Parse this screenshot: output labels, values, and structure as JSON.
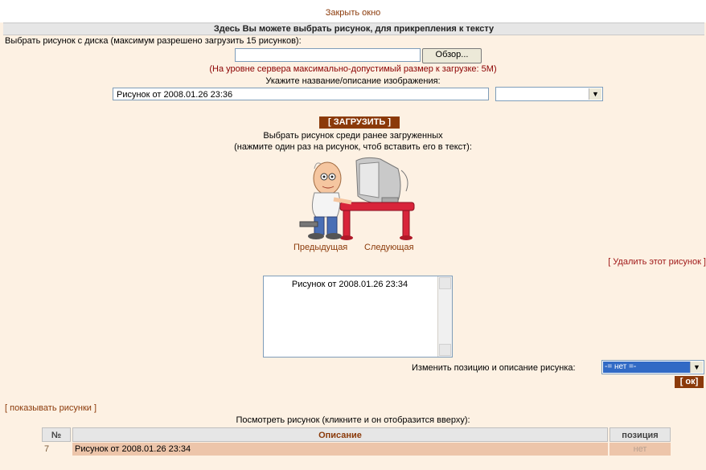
{
  "header": {
    "close_label": "Закрыть окно",
    "title": "Здесь Вы можете выбрать рисунок, для прикрепления к тексту"
  },
  "upload": {
    "instruction": "Выбрать рисунок с диска (максимум разрешено загрузить 15 рисунков):",
    "browse_label": "Обзор...",
    "server_note": "(На уровне сервера максимально-допустимый размер к загрузке: 5M)",
    "description_label": "Укажите название/описание изображения:",
    "description_value": "Рисунок от 2008.01.26 23:36",
    "upload_button": "[ ЗАГРУЗИТЬ ]"
  },
  "gallery": {
    "choose_label": "Выбрать рисунок среди ранее загруженных",
    "choose_hint": "(нажмите один раз на рисунок, чтоб вставить его в текст):",
    "prev_label": "Предыдущая",
    "next_label": "Следующая",
    "delete_label": "[ Удалить этот рисунок ]",
    "list_items": [
      "Рисунок от 2008.01.26 23:34"
    ],
    "change_label": "Изменить позицию и описание рисунка:",
    "change_select_value": "-= нет =-",
    "ok_label": "[ ок]"
  },
  "table": {
    "show_pictures_label": "[ показывать рисунки ]",
    "view_label": "Посмотреть рисунок (кликните и он отобразится вверху):",
    "headers": {
      "num": "№",
      "description": "Описание",
      "position": "позиция"
    },
    "rows": [
      {
        "num": "7",
        "description": "Рисунок от 2008.01.26 23:34",
        "position": "нет"
      }
    ]
  }
}
